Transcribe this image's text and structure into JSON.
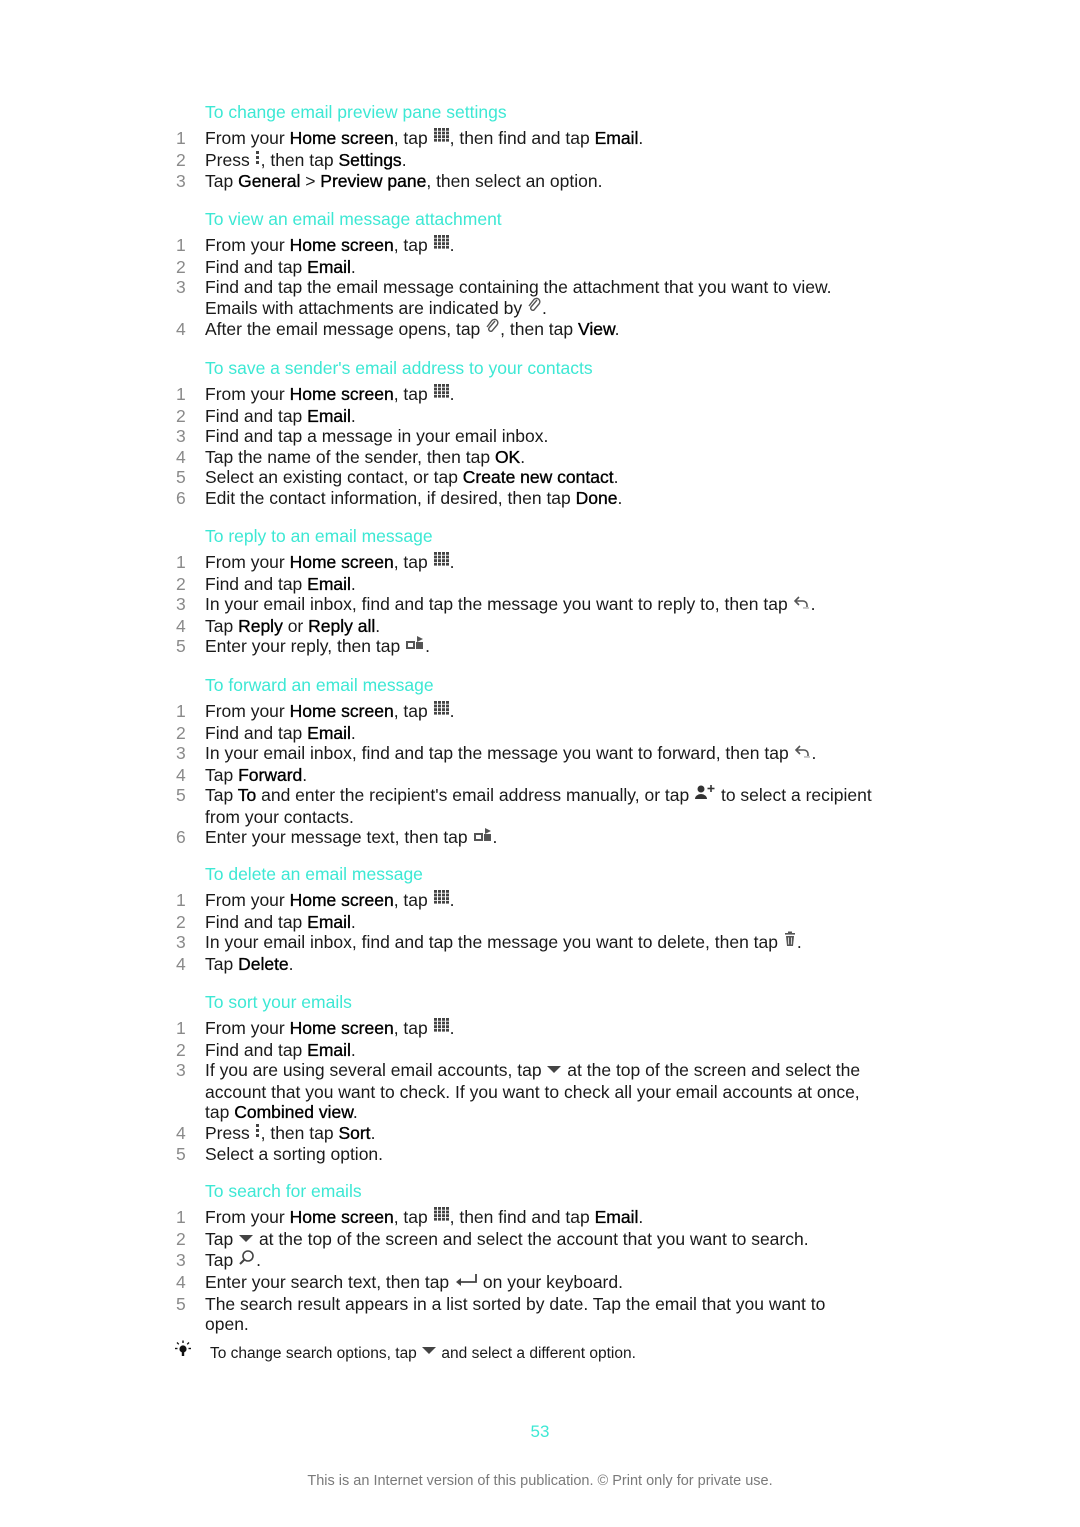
{
  "colors": {
    "heading": "#3de8d4",
    "step_number": "#8a8a8a",
    "footer": "#7a7a7a"
  },
  "sections": [
    {
      "title": "To change email preview pane settings",
      "steps": [
        {
          "n": "1",
          "parts": [
            [
              "t",
              "From your "
            ],
            [
              "b",
              "Home screen"
            ],
            [
              "t",
              ", tap "
            ],
            [
              "i",
              "apps-grid-icon"
            ],
            [
              "t",
              ", then find and tap "
            ],
            [
              "b",
              "Email"
            ],
            [
              "t",
              "."
            ]
          ]
        },
        {
          "n": "2",
          "parts": [
            [
              "t",
              "Press "
            ],
            [
              "i",
              "menu-dots-icon"
            ],
            [
              "t",
              ", then tap "
            ],
            [
              "b",
              "Settings"
            ],
            [
              "t",
              "."
            ]
          ]
        },
        {
          "n": "3",
          "parts": [
            [
              "t",
              "Tap "
            ],
            [
              "b",
              "General"
            ],
            [
              "t",
              " > "
            ],
            [
              "b",
              "Preview pane"
            ],
            [
              "t",
              ", then select an option."
            ]
          ]
        }
      ]
    },
    {
      "title": "To view an email message attachment",
      "steps": [
        {
          "n": "1",
          "parts": [
            [
              "t",
              "From your "
            ],
            [
              "b",
              "Home screen"
            ],
            [
              "t",
              ", tap "
            ],
            [
              "i",
              "apps-grid-icon"
            ],
            [
              "t",
              "."
            ]
          ]
        },
        {
          "n": "2",
          "parts": [
            [
              "t",
              "Find and tap "
            ],
            [
              "b",
              "Email"
            ],
            [
              "t",
              "."
            ]
          ]
        },
        {
          "n": "3",
          "parts": [
            [
              "t",
              "Find and tap the email message containing the attachment that you want to view. Emails with attachments are indicated by "
            ],
            [
              "i",
              "paperclip-icon"
            ],
            [
              "t",
              "."
            ]
          ]
        },
        {
          "n": "4",
          "parts": [
            [
              "t",
              "After the email message opens, tap "
            ],
            [
              "i",
              "paperclip-icon"
            ],
            [
              "t",
              ", then tap "
            ],
            [
              "b",
              "View"
            ],
            [
              "t",
              "."
            ]
          ]
        }
      ]
    },
    {
      "title": "To save a sender's email address to your contacts",
      "steps": [
        {
          "n": "1",
          "parts": [
            [
              "t",
              "From your "
            ],
            [
              "b",
              "Home screen"
            ],
            [
              "t",
              ", tap "
            ],
            [
              "i",
              "apps-grid-icon"
            ],
            [
              "t",
              "."
            ]
          ]
        },
        {
          "n": "2",
          "parts": [
            [
              "t",
              "Find and tap "
            ],
            [
              "b",
              "Email"
            ],
            [
              "t",
              "."
            ]
          ]
        },
        {
          "n": "3",
          "parts": [
            [
              "t",
              "Find and tap a message in your email inbox."
            ]
          ]
        },
        {
          "n": "4",
          "parts": [
            [
              "t",
              "Tap the name of the sender, then tap "
            ],
            [
              "b",
              "OK"
            ],
            [
              "t",
              "."
            ]
          ]
        },
        {
          "n": "5",
          "parts": [
            [
              "t",
              "Select an existing contact, or tap "
            ],
            [
              "b",
              "Create new contact"
            ],
            [
              "t",
              "."
            ]
          ]
        },
        {
          "n": "6",
          "parts": [
            [
              "t",
              "Edit the contact information, if desired, then tap "
            ],
            [
              "b",
              "Done"
            ],
            [
              "t",
              "."
            ]
          ]
        }
      ]
    },
    {
      "title": "To reply to an email message",
      "steps": [
        {
          "n": "1",
          "parts": [
            [
              "t",
              "From your "
            ],
            [
              "b",
              "Home screen"
            ],
            [
              "t",
              ", tap "
            ],
            [
              "i",
              "apps-grid-icon"
            ],
            [
              "t",
              "."
            ]
          ]
        },
        {
          "n": "2",
          "parts": [
            [
              "t",
              "Find and tap "
            ],
            [
              "b",
              "Email"
            ],
            [
              "t",
              "."
            ]
          ]
        },
        {
          "n": "3",
          "parts": [
            [
              "t",
              "In your email inbox, find and tap the message you want to reply to, then tap "
            ],
            [
              "i",
              "reply-arrow-icon"
            ],
            [
              "t",
              "."
            ]
          ]
        },
        {
          "n": "4",
          "parts": [
            [
              "t",
              "Tap "
            ],
            [
              "b",
              "Reply"
            ],
            [
              "t",
              " or "
            ],
            [
              "b",
              "Reply all"
            ],
            [
              "t",
              "."
            ]
          ]
        },
        {
          "n": "5",
          "parts": [
            [
              "t",
              "Enter your reply, then tap "
            ],
            [
              "i",
              "send-icon"
            ],
            [
              "t",
              "."
            ]
          ]
        }
      ]
    },
    {
      "title": "To forward an email message",
      "steps": [
        {
          "n": "1",
          "parts": [
            [
              "t",
              "From your "
            ],
            [
              "b",
              "Home screen"
            ],
            [
              "t",
              ", tap "
            ],
            [
              "i",
              "apps-grid-icon"
            ],
            [
              "t",
              "."
            ]
          ]
        },
        {
          "n": "2",
          "parts": [
            [
              "t",
              "Find and tap "
            ],
            [
              "b",
              "Email"
            ],
            [
              "t",
              "."
            ]
          ]
        },
        {
          "n": "3",
          "parts": [
            [
              "t",
              "In your email inbox, find and tap the message you want to forward, then tap "
            ],
            [
              "i",
              "reply-arrow-icon"
            ],
            [
              "t",
              "."
            ]
          ]
        },
        {
          "n": "4",
          "parts": [
            [
              "t",
              "Tap "
            ],
            [
              "b",
              "Forward"
            ],
            [
              "t",
              "."
            ]
          ]
        },
        {
          "n": "5",
          "parts": [
            [
              "t",
              "Tap "
            ],
            [
              "b",
              "To"
            ],
            [
              "t",
              " and enter the recipient's email address manually, or tap "
            ],
            [
              "i",
              "add-contact-icon"
            ],
            [
              "t",
              " to select a recipient from your contacts."
            ]
          ]
        },
        {
          "n": "6",
          "parts": [
            [
              "t",
              "Enter your message text, then tap "
            ],
            [
              "i",
              "send-icon"
            ],
            [
              "t",
              "."
            ]
          ]
        }
      ]
    },
    {
      "title": "To delete an email message",
      "steps": [
        {
          "n": "1",
          "parts": [
            [
              "t",
              "From your "
            ],
            [
              "b",
              "Home screen"
            ],
            [
              "t",
              ", tap "
            ],
            [
              "i",
              "apps-grid-icon"
            ],
            [
              "t",
              "."
            ]
          ]
        },
        {
          "n": "2",
          "parts": [
            [
              "t",
              "Find and tap "
            ],
            [
              "b",
              "Email"
            ],
            [
              "t",
              "."
            ]
          ]
        },
        {
          "n": "3",
          "parts": [
            [
              "t",
              "In your email inbox, find and tap the message you want to delete, then tap "
            ],
            [
              "i",
              "trash-icon"
            ],
            [
              "t",
              "."
            ]
          ]
        },
        {
          "n": "4",
          "parts": [
            [
              "t",
              "Tap "
            ],
            [
              "b",
              "Delete"
            ],
            [
              "t",
              "."
            ]
          ]
        }
      ]
    },
    {
      "title": "To sort your emails",
      "steps": [
        {
          "n": "1",
          "parts": [
            [
              "t",
              "From your "
            ],
            [
              "b",
              "Home screen"
            ],
            [
              "t",
              ", tap "
            ],
            [
              "i",
              "apps-grid-icon"
            ],
            [
              "t",
              "."
            ]
          ]
        },
        {
          "n": "2",
          "parts": [
            [
              "t",
              "Find and tap "
            ],
            [
              "b",
              "Email"
            ],
            [
              "t",
              "."
            ]
          ]
        },
        {
          "n": "3",
          "parts": [
            [
              "t",
              "If you are using several email accounts, tap "
            ],
            [
              "i",
              "dropdown-triangle-icon"
            ],
            [
              "t",
              " at the top of the screen and select the account that you want to check. If you want to check all your email accounts at once, tap "
            ],
            [
              "b",
              "Combined view"
            ],
            [
              "t",
              "."
            ]
          ]
        },
        {
          "n": "4",
          "parts": [
            [
              "t",
              "Press "
            ],
            [
              "i",
              "menu-dots-icon"
            ],
            [
              "t",
              ", then tap "
            ],
            [
              "b",
              "Sort"
            ],
            [
              "t",
              "."
            ]
          ]
        },
        {
          "n": "5",
          "parts": [
            [
              "t",
              "Select a sorting option."
            ]
          ]
        }
      ]
    },
    {
      "title": "To search for emails",
      "steps": [
        {
          "n": "1",
          "parts": [
            [
              "t",
              "From your "
            ],
            [
              "b",
              "Home screen"
            ],
            [
              "t",
              ", tap "
            ],
            [
              "i",
              "apps-grid-icon"
            ],
            [
              "t",
              ", then find and tap "
            ],
            [
              "b",
              "Email"
            ],
            [
              "t",
              "."
            ]
          ]
        },
        {
          "n": "2",
          "parts": [
            [
              "t",
              "Tap "
            ],
            [
              "i",
              "dropdown-triangle-icon"
            ],
            [
              "t",
              " at the top of the screen and select the account that you want to search."
            ]
          ]
        },
        {
          "n": "3",
          "parts": [
            [
              "t",
              "Tap "
            ],
            [
              "i",
              "search-icon"
            ],
            [
              "t",
              "."
            ]
          ]
        },
        {
          "n": "4",
          "parts": [
            [
              "t",
              "Enter your search text, then tap "
            ],
            [
              "i",
              "enter-key-icon"
            ],
            [
              "t",
              " on your keyboard."
            ]
          ]
        },
        {
          "n": "5",
          "parts": [
            [
              "t",
              "The search result appears in a list sorted by date. Tap the email that you want to open."
            ]
          ]
        }
      ]
    }
  ],
  "tip": {
    "icon": "lightbulb-icon",
    "parts": [
      [
        "t",
        "To change search options, tap "
      ],
      [
        "i",
        "dropdown-triangle-icon"
      ],
      [
        "t",
        " and select a different option."
      ]
    ]
  },
  "page_number": "53",
  "footer": "This is an Internet version of this publication. © Print only for private use."
}
